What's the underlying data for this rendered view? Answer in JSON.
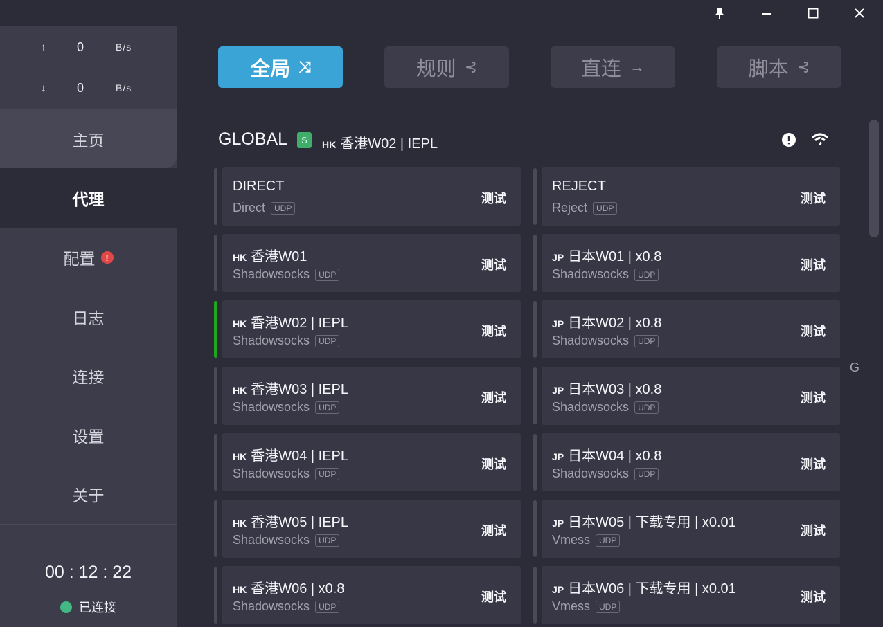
{
  "titlebar": {
    "icons": [
      "pin-icon",
      "minimize-icon",
      "maximize-icon",
      "close-icon"
    ]
  },
  "traffic": {
    "up_arrow": "↑",
    "up_value": "0",
    "up_unit": "B/s",
    "down_arrow": "↓",
    "down_value": "0",
    "down_unit": "B/s"
  },
  "nav": {
    "home": "主页",
    "proxy": "代理",
    "config": "配置",
    "config_badge": "!",
    "log": "日志",
    "connections": "连接",
    "settings": "设置",
    "about": "关于",
    "active": "proxy"
  },
  "footer": {
    "timer": "00 : 12 : 22",
    "status": "已连接",
    "status_color": "#43b883"
  },
  "modes": {
    "global": "全局",
    "rule": "规则",
    "direct": "直连",
    "script": "脚本",
    "active": "global"
  },
  "group": {
    "name": "GLOBAL",
    "badge": "S",
    "current_cc": "HK",
    "current": "香港W02 | IEPL"
  },
  "proxies": [
    {
      "cc": "",
      "name": "DIRECT",
      "type": "Direct",
      "udp": "UDP",
      "test": "测试"
    },
    {
      "cc": "",
      "name": "REJECT",
      "type": "Reject",
      "udp": "UDP",
      "test": "测试"
    },
    {
      "cc": "HK",
      "name": "香港W01",
      "type": "Shadowsocks",
      "udp": "UDP",
      "test": "测试"
    },
    {
      "cc": "JP",
      "name": "日本W01 | x0.8",
      "type": "Shadowsocks",
      "udp": "UDP",
      "test": "测试"
    },
    {
      "cc": "HK",
      "name": "香港W02 | IEPL",
      "type": "Shadowsocks",
      "udp": "UDP",
      "test": "测试"
    },
    {
      "cc": "JP",
      "name": "日本W02 | x0.8",
      "type": "Shadowsocks",
      "udp": "UDP",
      "test": "测试"
    },
    {
      "cc": "HK",
      "name": "香港W03 | IEPL",
      "type": "Shadowsocks",
      "udp": "UDP",
      "test": "测试"
    },
    {
      "cc": "JP",
      "name": "日本W03 | x0.8",
      "type": "Shadowsocks",
      "udp": "UDP",
      "test": "测试"
    },
    {
      "cc": "HK",
      "name": "香港W04 | IEPL",
      "type": "Shadowsocks",
      "udp": "UDP",
      "test": "测试"
    },
    {
      "cc": "JP",
      "name": "日本W04 | x0.8",
      "type": "Shadowsocks",
      "udp": "UDP",
      "test": "测试"
    },
    {
      "cc": "HK",
      "name": "香港W05 | IEPL",
      "type": "Shadowsocks",
      "udp": "UDP",
      "test": "测试"
    },
    {
      "cc": "JP",
      "name": "日本W05 | 下载专用 | x0.01",
      "type": "Vmess",
      "udp": "UDP",
      "test": "测试"
    },
    {
      "cc": "HK",
      "name": "香港W06 | x0.8",
      "type": "Shadowsocks",
      "udp": "UDP",
      "test": "测试"
    },
    {
      "cc": "JP",
      "name": "日本W06 | 下载专用 | x0.01",
      "type": "Vmess",
      "udp": "UDP",
      "test": "测试"
    }
  ],
  "selected_index": 4,
  "index_letter": "G",
  "colors": {
    "accent": "#3ba4d6",
    "selected_bar": "#1fa81f",
    "badge_s": "#3fae6b",
    "alert": "#e04848"
  }
}
